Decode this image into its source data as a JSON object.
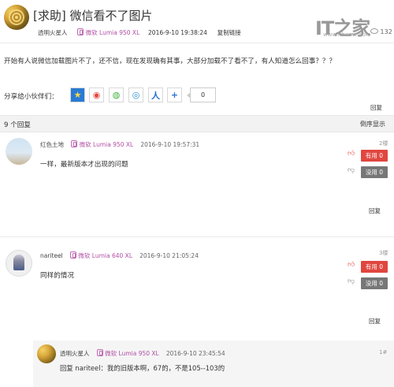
{
  "post": {
    "title": "[求助] 微信看不了图片",
    "author": "透明火星人",
    "device": "微软 Lumia 950 XL",
    "time": "2016-9-10 19:38:24",
    "copy_link": "复制链接",
    "views": "132",
    "body": "开始有人说微信加载图片不了，还不信，现在发现确有其事，大部分加载不了看不了，有人知道怎么回事？？？",
    "share_label": "分享给小伙伴们：",
    "share_count": "0",
    "reply_link": "回复"
  },
  "logo": {
    "text": "IT之家",
    "url": "www.ithome.com"
  },
  "replies_bar": {
    "count": "9 个回复",
    "sort": "倒序显示"
  },
  "comments": [
    {
      "author": "红色土地",
      "device": "微软 Lumia 950 XL",
      "time": "2016-9-10 19:57:31",
      "floor": "2楼",
      "text": "一样，最新版本才出现的问题",
      "up": "有用 0",
      "down": "没用 0",
      "reply": "回复"
    },
    {
      "author": "nariteel",
      "device": "微软 Lumia 640 XL",
      "time": "2016-9-10 21:05:24",
      "floor": "3楼",
      "text": "同样的情况",
      "up": "有用 0",
      "down": "没用 0",
      "reply": "回复"
    }
  ],
  "nested_reply": {
    "author": "透明火星人",
    "device": "微软 Lumia 950 XL",
    "time": "2016-9-10 23:45:54",
    "floor": "1#",
    "text": "回复 nariteel：我的旧版本啊，67的，不是105--103的"
  }
}
